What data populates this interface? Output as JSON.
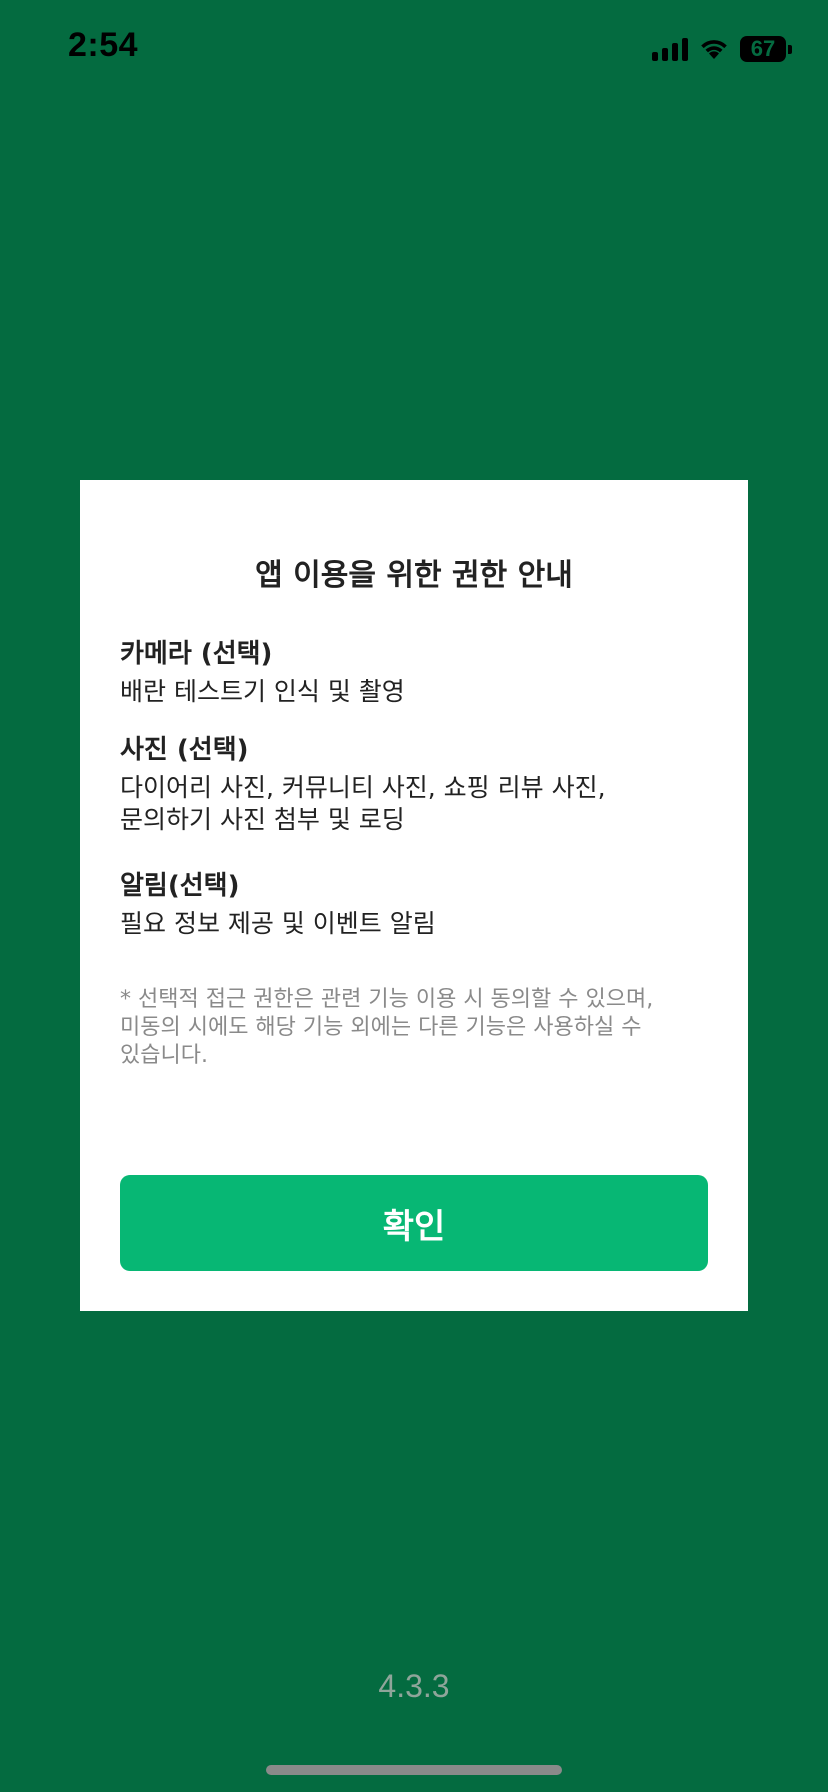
{
  "status_bar": {
    "time": "2:54",
    "battery": "67",
    "icons": [
      "cellular-signal-icon",
      "wifi-icon",
      "battery-icon"
    ]
  },
  "dialog": {
    "title": "앱 이용을 위한 권한 안내",
    "permissions": [
      {
        "title": "카메라 (선택)",
        "desc": "배란 테스트기 인식 및 촬영"
      },
      {
        "title": "사진 (선택)",
        "desc": "다이어리 사진, 커뮤니티 사진, 쇼핑 리뷰 사진,\n문의하기 사진 첨부 및 로딩"
      },
      {
        "title": "알림(선택)",
        "desc": "필요 정보 제공 및 이벤트 알림"
      }
    ],
    "note": "* 선택적 접근 권한은 관련 기능 이용 시 동의할 수 있으며,\n미동의 시에도 해당 기능 외에는 다른 기능은 사용하실 수\n있습니다.",
    "confirm_label": "확인"
  },
  "version": "4.3.3",
  "colors": {
    "background": "#046b40",
    "accent": "#07b774",
    "dialog": "#ffffff"
  }
}
